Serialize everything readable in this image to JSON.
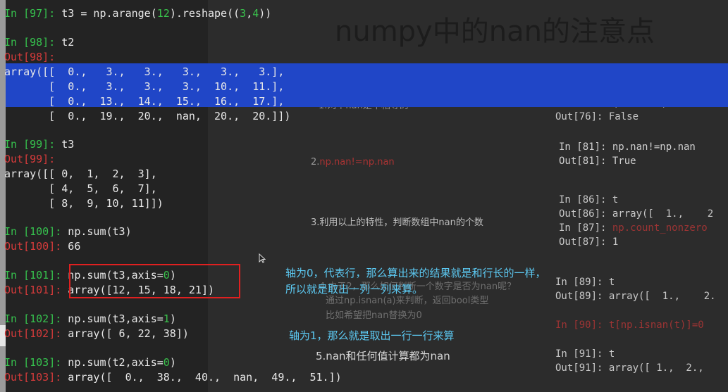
{
  "slide": {
    "title": "numpy中的nan的注意点",
    "points": {
      "p1": "1.两个nan是不相等的",
      "p2_num": "2.",
      "p2_code": "np.nan!=np.nan",
      "p3": "3.利用以上的特性，判断数组中nan的个数",
      "p4a": "4.由于2，那么如何判断一个数字是否为nan呢？",
      "p4b": "通过np.isnan(a)来判断，返回bool类型",
      "p4c": "比如希望把nan替换为0",
      "p5": "5.nan和任何值计算都为nan"
    },
    "right_code": {
      "l1": "In [76]: np.nan==np.nan",
      "l2": "Out[76]: False",
      "l3": "In [81]: np.nan!=np.nan",
      "l4": "Out[81]: True",
      "l5": "In [86]: t",
      "l6": "Out[86]: array([  1.,    2",
      "l7a": "In [87]: ",
      "l7b": "np.count_nonzero",
      "l8": "Out[87]: 1",
      "l9": "In [89]: t",
      "l10": "Out[89]: array([  1.,    2.",
      "l11": "In [90]: t[np.isnan(t)]=0",
      "l12": "In [91]: t",
      "l13": "Out[91]: array([ 1.,  2.,"
    }
  },
  "notebook": {
    "c97": {
      "prompt": "In [97]:",
      "code_a": " t3 = np.arange(",
      "n1": "12",
      "code_b": ").reshape((",
      "n2": "3",
      "code_c": ",",
      "n3": "4",
      "code_d": "))"
    },
    "c98": {
      "prompt": "In [98]:",
      "code": " t2",
      "out": "Out[98]:",
      "rows": [
        "array([[  0.,   3.,   3.,   3.,   3.,   3.],",
        "       [  0.,   3.,   3.,   3.,  10.,  11.],",
        "       [  0.,  13.,  14.,  15.,  16.,  17.],",
        "       [  0.,  19.,  20.,  nan,  20.,  20.]])"
      ]
    },
    "c99": {
      "prompt": "In [99]:",
      "code": " t3",
      "out": "Out[99]:",
      "rows": [
        "array([[ 0,  1,  2,  3],",
        "       [ 4,  5,  6,  7],",
        "       [ 8,  9, 10, 11]])"
      ]
    },
    "c100": {
      "prompt": "In [100]:",
      "code": " np.sum(t3)",
      "out": "Out[100]:",
      "result": " 66"
    },
    "c101": {
      "prompt": "In [101]:",
      "code_a": " np.sum(t3,axis=",
      "n": "0",
      "code_b": ")",
      "out": "Out[101]:",
      "result": " array([12, 15, 18, 21])"
    },
    "c102": {
      "prompt": "In [102]:",
      "code_a": " np.sum(t3,axis=",
      "n": "1",
      "code_b": ")",
      "out": "Out[102]:",
      "result": " array([ 6, 22, 38])"
    },
    "c103": {
      "prompt": "In [103]:",
      "code_a": " np.sum(t2,axis=",
      "n": "0",
      "code_b": ")",
      "out": "Out[103]:",
      "result": " array([  0.,  38.,  40.,  nan,  49.,  51.])"
    }
  },
  "annotations": {
    "axis0_line1": "轴为0，代表行，那么算出来的结果就是和行长的一样，",
    "axis0_line2": "所以就是取出一列一列来算。",
    "axis1": "轴为1，那么就是取出一行一行来算"
  },
  "colors": {
    "prompt_in": "#36c24e",
    "prompt_out": "#d63b3b",
    "highlight": "#2046c7",
    "note": "#5cc9f2",
    "redbox": "#e02020"
  }
}
